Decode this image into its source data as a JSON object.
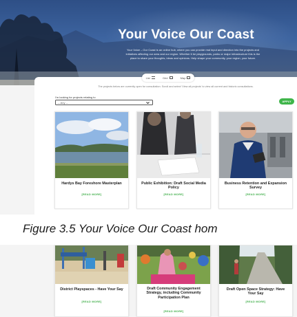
{
  "hero": {
    "title": "Your Voice Our Coast",
    "description": "Your Voice – Our Coast is an online hub, where you can provide real input and direction into the projects and initiatives affecting our area and our region. Whether it be playgrounds, parks or major infrastructure this is the place to share your thoughts, ideas and opinions. Help shape your community, your region, your future."
  },
  "view_switch": {
    "list": "List",
    "grid": "Grid",
    "map": "Map"
  },
  "notice": "The projects below are currently open for consultation. Scroll and select 'View all projects' to view all current and historic consultations.",
  "filter": {
    "label": "I'm looking for projects relating to",
    "selected": "-- Any --",
    "apply": "APPLY"
  },
  "cards_top": [
    {
      "title": "Hardys Bay Foreshore Masterplan",
      "link": "[READ MORE]"
    },
    {
      "title": "Public Exhibition: Draft Social Media Policy",
      "link": "[READ MORE]"
    },
    {
      "title": "Business Retention and Expansion Survey",
      "link": "[READ MORE]"
    }
  ],
  "caption": "Figure 3.5 Your Voice Our Coast hom",
  "cards_bottom": [
    {
      "title": "District Playspaces - Have Your Say",
      "link": "[READ MORE]"
    },
    {
      "title": "Draft Community Engagement Strategy, including Community Participation Plan",
      "link": "[READ MORE]"
    },
    {
      "title": "Draft Open Space Strategy: Have Your Say",
      "link": "[READ MORE]"
    }
  ],
  "colors": {
    "accent_green": "#3fb54a",
    "hero_blue": "#3d64a0"
  }
}
